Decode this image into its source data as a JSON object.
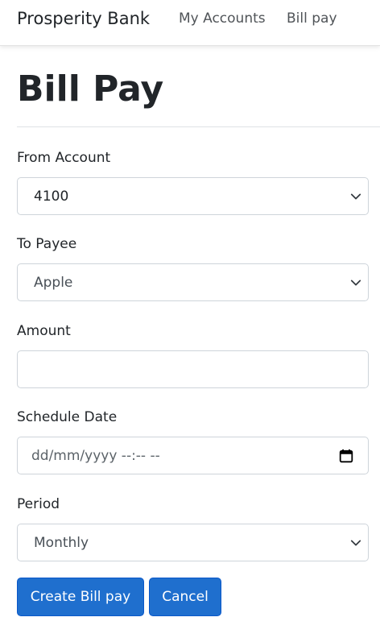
{
  "navbar": {
    "brand": "Prosperity Bank",
    "links": [
      {
        "label": "My Accounts"
      },
      {
        "label": "Bill pay"
      }
    ]
  },
  "page": {
    "title": "Bill Pay"
  },
  "form": {
    "from_account": {
      "label": "From Account",
      "value": "4100"
    },
    "to_payee": {
      "label": "To Payee",
      "value": "Apple"
    },
    "amount": {
      "label": "Amount",
      "value": ""
    },
    "schedule_date": {
      "label": "Schedule Date",
      "placeholder": "dd/mm/yyyy --:-- --"
    },
    "period": {
      "label": "Period",
      "value": "Monthly"
    }
  },
  "actions": {
    "create_label": "Create Bill pay",
    "cancel_label": "Cancel"
  },
  "colors": {
    "primary": "#1f6fce",
    "text": "#212529",
    "border": "#ced4da"
  },
  "icons": {
    "select": "chevron-down-icon",
    "date": "calendar-icon"
  }
}
